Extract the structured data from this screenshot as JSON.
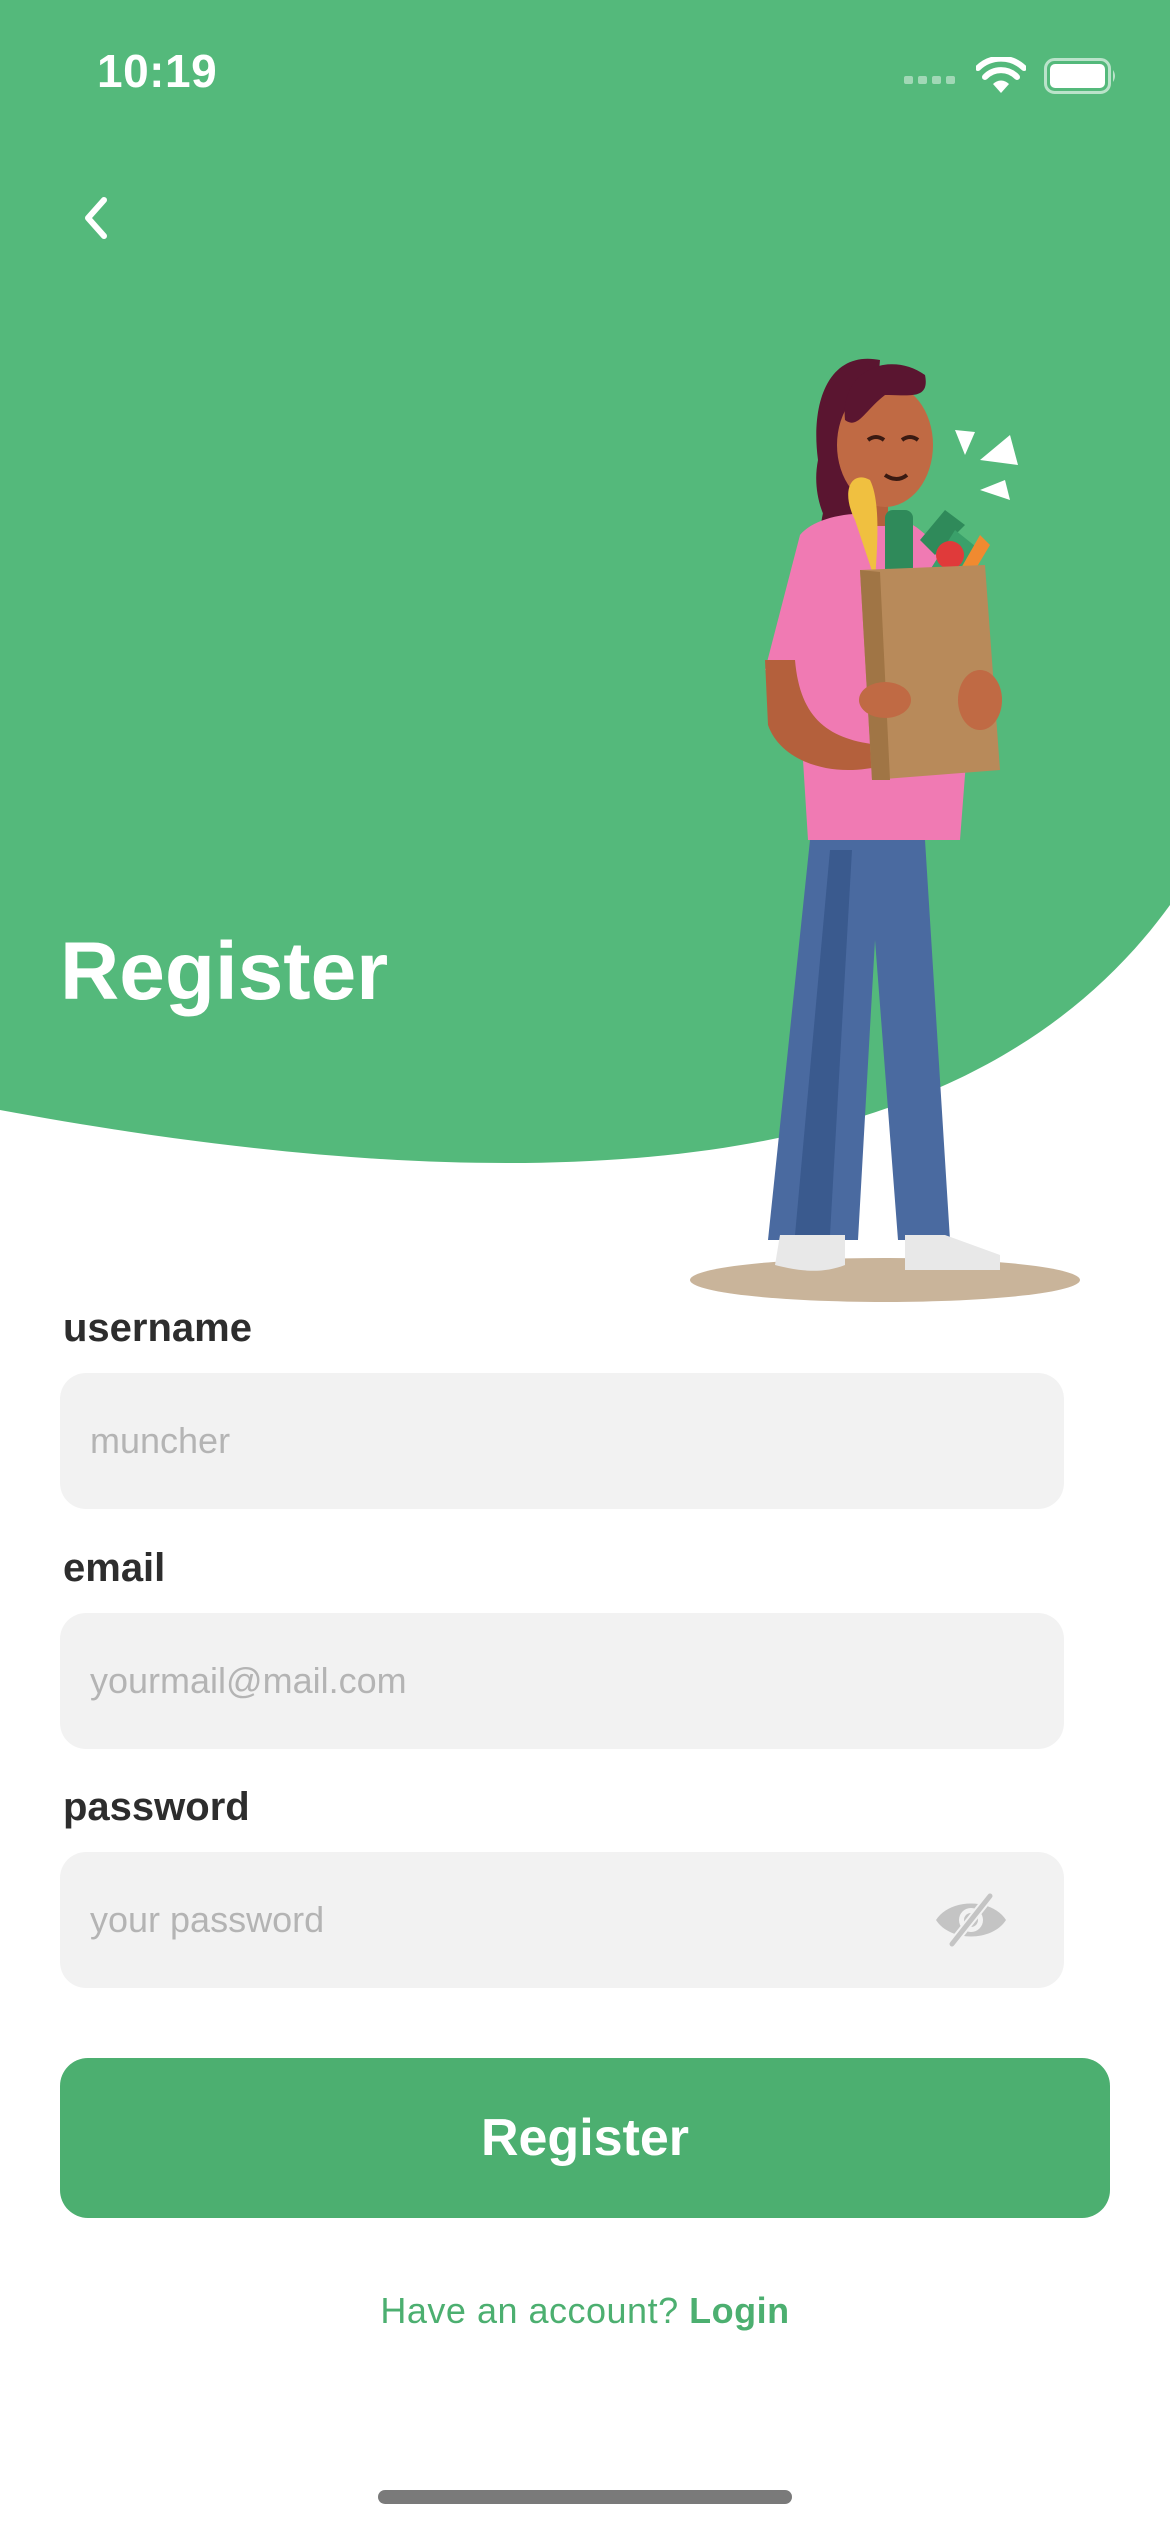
{
  "status_bar": {
    "time": "10:19"
  },
  "page": {
    "title": "Register"
  },
  "form": {
    "username": {
      "label": "username",
      "placeholder": "muncher",
      "value": ""
    },
    "email": {
      "label": "email",
      "placeholder": "yourmail@mail.com",
      "value": ""
    },
    "password": {
      "label": "password",
      "placeholder": "your password",
      "value": ""
    }
  },
  "actions": {
    "register_label": "Register"
  },
  "footer": {
    "prompt": "Have an account?",
    "login_label": "Login"
  },
  "icons": {
    "back": "chevron-left-icon",
    "password_visibility": "eye-off-icon",
    "signal": "cellular-signal-icon",
    "wifi": "wifi-icon",
    "battery": "battery-icon"
  },
  "colors": {
    "header_green": "#54b97b",
    "accent_green": "#4caf70",
    "input_bg": "#f2f2f2"
  }
}
